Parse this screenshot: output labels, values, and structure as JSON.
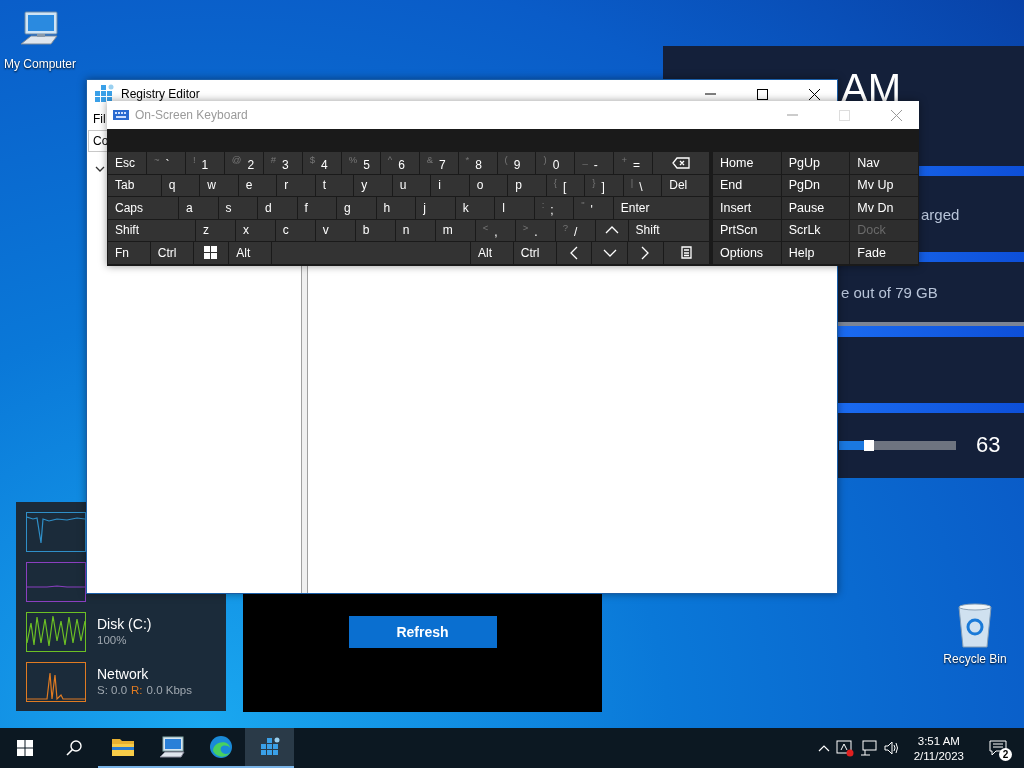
{
  "desktop_icons": [
    {
      "kind": "computer",
      "label": "My Computer"
    },
    {
      "kind": "recycle-bin",
      "label": "Recycle Bin"
    }
  ],
  "clock_widget": {
    "time_fragment": "AM",
    "battery_fragment": "arged",
    "storage_fragment": "e out of 79 GB",
    "volume": {
      "level": 0.23,
      "reading": "63"
    }
  },
  "system_monitor": {
    "graphs": [
      {
        "color": "#2f8fc8"
      },
      {
        "color": "#8a3fc0"
      },
      {
        "color": "#6cc024"
      },
      {
        "color": "#e07b22"
      }
    ],
    "disk": {
      "label": "Disk (C:)",
      "value": "100%"
    },
    "network": {
      "label": "Network",
      "send": "S: 0.0",
      "receive_label": "R:",
      "receive": "0.0 Kbps"
    }
  },
  "weather_widget": {
    "button": "Refresh"
  },
  "registry_editor": {
    "title": "Registry Editor",
    "menu_fragment": "Fil",
    "address_fragment": "Co"
  },
  "on_screen_keyboard": {
    "title": "On-Screen Keyboard",
    "main_rows": [
      [
        {
          "kind": "text",
          "label": "Esc"
        },
        {
          "kind": "text",
          "label": "`",
          "shift": "~"
        },
        {
          "kind": "text",
          "label": "1",
          "shift": "!"
        },
        {
          "kind": "text",
          "label": "2",
          "shift": "@"
        },
        {
          "kind": "text",
          "label": "3",
          "shift": "#"
        },
        {
          "kind": "text",
          "label": "4",
          "shift": "$"
        },
        {
          "kind": "text",
          "label": "5",
          "shift": "%"
        },
        {
          "kind": "text",
          "label": "6",
          "shift": "^"
        },
        {
          "kind": "text",
          "label": "7",
          "shift": "&"
        },
        {
          "kind": "text",
          "label": "8",
          "shift": "*"
        },
        {
          "kind": "text",
          "label": "9",
          "shift": "("
        },
        {
          "kind": "text",
          "label": "0",
          "shift": ")"
        },
        {
          "kind": "text",
          "label": "-",
          "shift": "_"
        },
        {
          "kind": "text",
          "label": "=",
          "shift": "+"
        },
        {
          "kind": "backspace"
        }
      ],
      [
        {
          "kind": "text",
          "label": "Tab"
        },
        {
          "kind": "text",
          "label": "q"
        },
        {
          "kind": "text",
          "label": "w"
        },
        {
          "kind": "text",
          "label": "e"
        },
        {
          "kind": "text",
          "label": "r"
        },
        {
          "kind": "text",
          "label": "t"
        },
        {
          "kind": "text",
          "label": "y"
        },
        {
          "kind": "text",
          "label": "u"
        },
        {
          "kind": "text",
          "label": "i"
        },
        {
          "kind": "text",
          "label": "o"
        },
        {
          "kind": "text",
          "label": "p"
        },
        {
          "kind": "text",
          "label": "[",
          "shift": "{"
        },
        {
          "kind": "text",
          "label": "]",
          "shift": "}"
        },
        {
          "kind": "text",
          "label": "\\",
          "shift": "|"
        },
        {
          "kind": "text",
          "label": "Del"
        }
      ],
      [
        {
          "kind": "text",
          "label": "Caps"
        },
        {
          "kind": "text",
          "label": "a"
        },
        {
          "kind": "text",
          "label": "s"
        },
        {
          "kind": "text",
          "label": "d"
        },
        {
          "kind": "text",
          "label": "f"
        },
        {
          "kind": "text",
          "label": "g"
        },
        {
          "kind": "text",
          "label": "h"
        },
        {
          "kind": "text",
          "label": "j"
        },
        {
          "kind": "text",
          "label": "k"
        },
        {
          "kind": "text",
          "label": "l"
        },
        {
          "kind": "text",
          "label": ";",
          "shift": ":"
        },
        {
          "kind": "text",
          "label": "'",
          "shift": "\""
        },
        {
          "kind": "text",
          "label": "Enter"
        }
      ],
      [
        {
          "kind": "text",
          "label": "Shift"
        },
        {
          "kind": "text",
          "label": "z"
        },
        {
          "kind": "text",
          "label": "x"
        },
        {
          "kind": "text",
          "label": "c"
        },
        {
          "kind": "text",
          "label": "v"
        },
        {
          "kind": "text",
          "label": "b"
        },
        {
          "kind": "text",
          "label": "n"
        },
        {
          "kind": "text",
          "label": "m"
        },
        {
          "kind": "text",
          "label": ",",
          "shift": "<"
        },
        {
          "kind": "text",
          "label": ".",
          "shift": ">"
        },
        {
          "kind": "text",
          "label": "/",
          "shift": "?"
        },
        {
          "kind": "up"
        },
        {
          "kind": "text",
          "label": "Shift"
        }
      ],
      [
        {
          "kind": "text",
          "label": "Fn"
        },
        {
          "kind": "text",
          "label": "Ctrl"
        },
        {
          "kind": "windows"
        },
        {
          "kind": "text",
          "label": "Alt"
        },
        {
          "kind": "space"
        },
        {
          "kind": "text",
          "label": "Alt"
        },
        {
          "kind": "text",
          "label": "Ctrl"
        },
        {
          "kind": "left"
        },
        {
          "kind": "down"
        },
        {
          "kind": "right"
        },
        {
          "kind": "menu"
        }
      ]
    ],
    "nav_rows": [
      [
        {
          "label": "Home",
          "disabled": false
        },
        {
          "label": "PgUp",
          "disabled": false
        },
        {
          "label": "Nav",
          "disabled": false
        }
      ],
      [
        {
          "label": "End",
          "disabled": false
        },
        {
          "label": "PgDn",
          "disabled": false
        },
        {
          "label": "Mv Up",
          "disabled": false
        }
      ],
      [
        {
          "label": "Insert",
          "disabled": false
        },
        {
          "label": "Pause",
          "disabled": false
        },
        {
          "label": "Mv Dn",
          "disabled": false
        }
      ],
      [
        {
          "label": "PrtScn",
          "disabled": false
        },
        {
          "label": "ScrLk",
          "disabled": false
        },
        {
          "label": "Dock",
          "disabled": true
        }
      ],
      [
        {
          "label": "Options",
          "disabled": false
        },
        {
          "label": "Help",
          "disabled": false
        },
        {
          "label": "Fade",
          "disabled": false
        }
      ]
    ]
  },
  "taskbar": {
    "apps": [
      {
        "kind": "folder",
        "running": true,
        "selected": false
      },
      {
        "kind": "computer",
        "running": true,
        "selected": false
      },
      {
        "kind": "edge",
        "running": true,
        "selected": false
      },
      {
        "kind": "registry",
        "running": true,
        "selected": true
      }
    ],
    "time": "3:51 AM",
    "date": "2/11/2023",
    "notification_count": "2"
  }
}
